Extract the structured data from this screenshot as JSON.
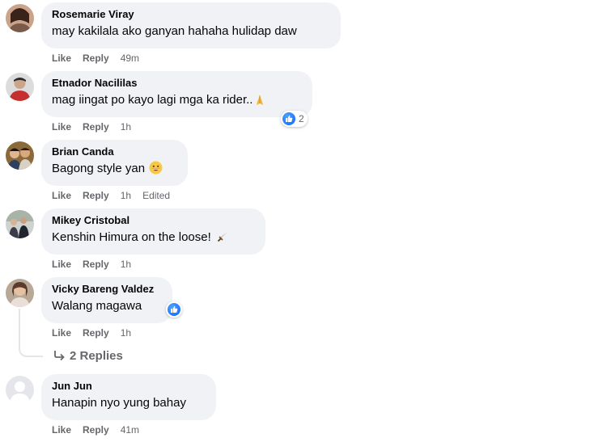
{
  "action_like": "Like",
  "action_reply": "Reply",
  "comments": [
    {
      "author": "Rosemarie Viray",
      "text": "may kakilala ako ganyan hahaha hulidap daw",
      "time": "49m",
      "avatar_icon": "woman-avatar-photo"
    },
    {
      "author": "Etnador Nacililas",
      "text": "mag iingat po kayo lagi mga ka rider..",
      "emoji_icon": "folded-hands-emoji",
      "time": "1h",
      "reaction_count": "2",
      "avatar_icon": "man-in-red-shirt-avatar"
    },
    {
      "author": "Brian Canda",
      "text": "Bagong style yan",
      "emoji_icon": "grinning-face-emoji",
      "time": "1h",
      "edited": "Edited",
      "avatar_icon": "couple-avatar-photo"
    },
    {
      "author": "Mikey Cristobal",
      "text": "Kenshin Himura on the loose!",
      "emoji_icon": "dagger-emoji",
      "time": "1h",
      "avatar_icon": "group-avatar-photo"
    },
    {
      "author": "Vicky Bareng Valdez",
      "text": "Walang magawa",
      "time": "1h",
      "reaction_icon": "like-reaction-icon",
      "avatar_icon": "woman-avatar-photo"
    },
    {
      "author": "Jun Jun",
      "text": "Hanapin nyo yung bahay",
      "time": "41m",
      "avatar_icon": "default-avatar-icon"
    }
  ],
  "replies_link": "2 Replies",
  "colors": {
    "bubble": "#f0f2f5",
    "meta": "#65676b",
    "like_blue": "#0866ff"
  }
}
